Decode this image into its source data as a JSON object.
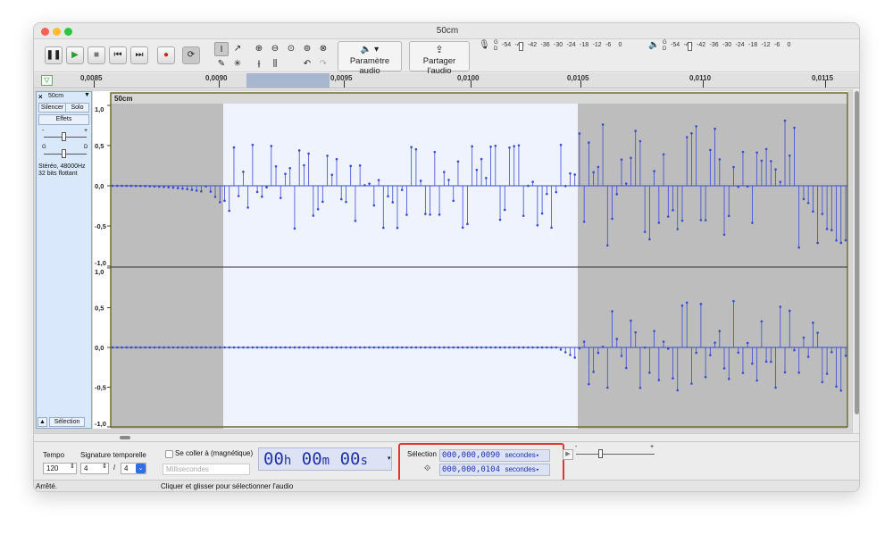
{
  "window": {
    "title": "50cm"
  },
  "toolbar": {
    "audio_setup_label": "Paramètre audio",
    "share_label": "Partager l'audio",
    "meter_scale": [
      "-54",
      "-48",
      "-42",
      "-36",
      "-30",
      "-24",
      "-18",
      "-12",
      "-6",
      "0"
    ],
    "meter_rec_lr": "G\nD",
    "meter_play_lr": "G\nD"
  },
  "timeline": {
    "ticks": [
      "0,0085",
      "0,0090",
      "0,0095",
      "0,0100",
      "0,0105",
      "0,0110",
      "0,0115"
    ]
  },
  "track": {
    "name": "50cm",
    "mute_label": "Silencer",
    "solo_label": "Solo",
    "effects_label": "Effets",
    "gain_minus": "-",
    "gain_plus": "+",
    "pan_left": "G",
    "pan_right": "D",
    "info_line1": "Stéréo, 48000Hz",
    "info_line2": "32 bits flottant",
    "select_label": "Sélection",
    "clip_title": "50cm",
    "y_labels": [
      "1,0",
      "0,5",
      "0,0",
      "-0,5",
      "-1,0"
    ]
  },
  "bottom": {
    "tempo_label": "Tempo",
    "tempo_value": "120",
    "timesig_label": "Signature temporelle",
    "timesig_num": "4",
    "timesig_sep": "/",
    "timesig_den": "4",
    "snap_label": "Se coller à (magnétique)",
    "snap_unit": "Millisecondes",
    "time_h": "00",
    "time_h_unit": "h",
    "time_m": "00",
    "time_m_unit": "m",
    "time_s": "00",
    "time_s_unit": "s",
    "selection_label": "Sélection",
    "sel_start": "000,000,0090",
    "sel_end": "000,000,0104",
    "unit": "secondes",
    "speed_minus": "-",
    "speed_plus": "+"
  },
  "status": {
    "left": "Arrêté.",
    "center": "Cliquer et glisser pour sélectionner l'audio"
  },
  "colors": {
    "accent": "#3b4bd0",
    "highlight_box": "#d93a2b",
    "selection_bg": "#eef3fd"
  }
}
